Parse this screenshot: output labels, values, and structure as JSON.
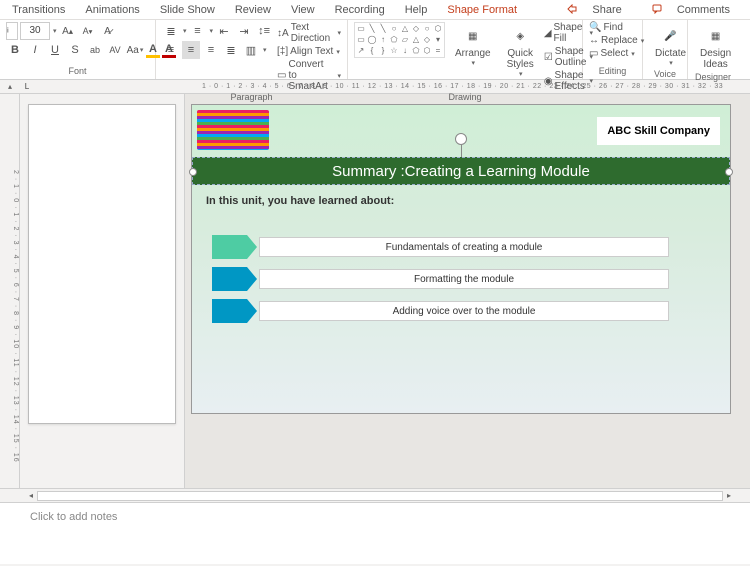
{
  "tabs": {
    "transitions": "Transitions",
    "animations": "Animations",
    "slideshow": "Slide Show",
    "review": "Review",
    "view": "View",
    "recording": "Recording",
    "help": "Help",
    "shapeformat": "Shape Format",
    "share": "Share",
    "comments": "Comments"
  },
  "ribbon": {
    "font": {
      "size": "30",
      "label": "Font"
    },
    "paragraph": {
      "text_direction": "Text Direction",
      "align_text": "Align Text",
      "convert_smartart": "Convert to SmartArt",
      "label": "Paragraph"
    },
    "drawing": {
      "arrange": "Arrange",
      "quick_styles": "Quick\nStyles",
      "shape_fill": "Shape Fill",
      "shape_outline": "Shape Outline",
      "shape_effects": "Shape Effects",
      "label": "Drawing"
    },
    "editing": {
      "find": "Find",
      "replace": "Replace",
      "select": "Select",
      "label": "Editing"
    },
    "voice": {
      "dictate": "Dictate",
      "label": "Voice"
    },
    "designer": {
      "ideas": "Design\nIdeas",
      "label": "Designer"
    }
  },
  "ruler": "1 · 0 · 1 · 2 · 3 · 4 · 5 · 6 · 7 · 8 · 9 · 10 · 11 · 12 · 13 · 14 · 15 · 16 · 17 · 18 · 19 · 20 · 21 · 22 · 23 · 24 · 25 · 26 · 27 · 28 · 29 · 30 · 31 · 32 · 33",
  "vruler": "2 · 1 · 0 · 1 · 2 · 3 · 4 · 5 · 6 · 7 · 8 · 9 · 10 · 11 · 12 · 13 · 14 · 15 · 16",
  "slide": {
    "company": "ABC Skill Company",
    "title": "Summary :Creating a Learning Module",
    "intro": "In this unit, you have learned about:",
    "bullets": {
      "b1": "Fundamentals of creating a module",
      "b2": "Formatting the module",
      "b3": "Adding voice over to the module"
    }
  },
  "notes": {
    "placeholder": "Click to add notes"
  }
}
